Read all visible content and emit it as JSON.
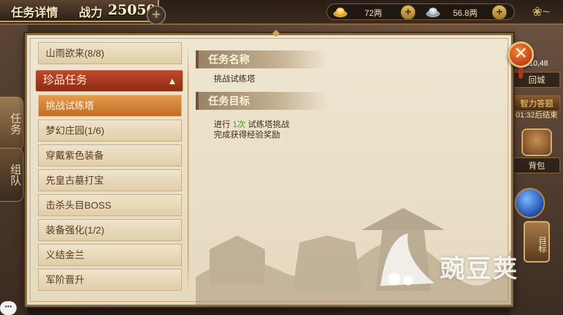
{
  "header": {
    "title": "任务详情",
    "power_label": "战力",
    "power_value": "25050"
  },
  "currency": {
    "gold": "72两",
    "silver": "56.8两"
  },
  "side_tabs": [
    {
      "label": "任务"
    },
    {
      "label": "组队"
    }
  ],
  "right_hud": {
    "coords": "110,48",
    "city": "回城",
    "event": "智力答题",
    "timer": "01:32后结束",
    "bag": "背包",
    "target": "目标"
  },
  "task_list": {
    "items_before": [
      {
        "label": "山雨欲来(8/8)"
      }
    ],
    "category": {
      "label": "珍品任务",
      "expanded": true
    },
    "items": [
      {
        "label": "挑战试练塔",
        "selected": true
      },
      {
        "label": "梦幻庄园(1/6)"
      },
      {
        "label": "穿戴紫色装备"
      },
      {
        "label": "先皇古墓打宝"
      },
      {
        "label": "击杀头目BOSS"
      },
      {
        "label": "装备强化(1/2)"
      },
      {
        "label": "义结金兰"
      },
      {
        "label": "军阶晋升"
      }
    ]
  },
  "detail": {
    "name_header": "任务名称",
    "name_value": "挑战试练塔",
    "goal_header": "任务目标",
    "goal_line1_pre": "进行",
    "goal_line1_count": "1次",
    "goal_line1_post": "试练塔挑战",
    "goal_line2": "完成获得经验奖励"
  },
  "watermark": {
    "text": "豌豆荚"
  },
  "colors": {
    "accent_red": "#8d2a16",
    "selected_orange": "#c26c26",
    "highlight_green": "#3d9a1e",
    "panel_bg": "#efe6d2"
  }
}
